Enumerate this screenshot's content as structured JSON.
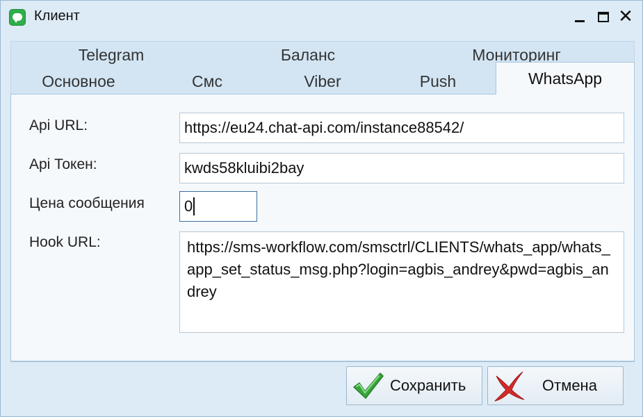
{
  "window": {
    "title": "Клиент",
    "app_icon": "chat-bubble-icon",
    "controls": {
      "minimize": "minimize-icon",
      "maximize": "maximize-icon",
      "close": "close-icon",
      "close_glyph": "✕"
    }
  },
  "tabs": {
    "back_row": [
      "Telegram",
      "Баланс",
      "Мониторинг"
    ],
    "front_row": [
      "Основное",
      "Смс",
      "Viber",
      "Push"
    ],
    "active": "WhatsApp"
  },
  "form": {
    "api_url": {
      "label": "Api URL:",
      "value": "https://eu24.chat-api.com/instance88542/"
    },
    "api_token": {
      "label": "Api Токен:",
      "value": "kwds58kluibi2bay"
    },
    "price": {
      "label": "Цена сообщения",
      "value": "0"
    },
    "hook_url": {
      "label": "Hook URL:",
      "value": "https://sms-workflow.com/smsctrl/CLIENTS/whats_app/whats_app_set_status_msg.php?login=agbis_andrey&pwd=agbis_andrey"
    }
  },
  "buttons": {
    "save": {
      "label": "Сохранить",
      "icon": "checkmark-icon",
      "color": "#3aa53a"
    },
    "cancel": {
      "label": "Отмена",
      "icon": "cross-icon",
      "color": "#d42a2a"
    }
  }
}
